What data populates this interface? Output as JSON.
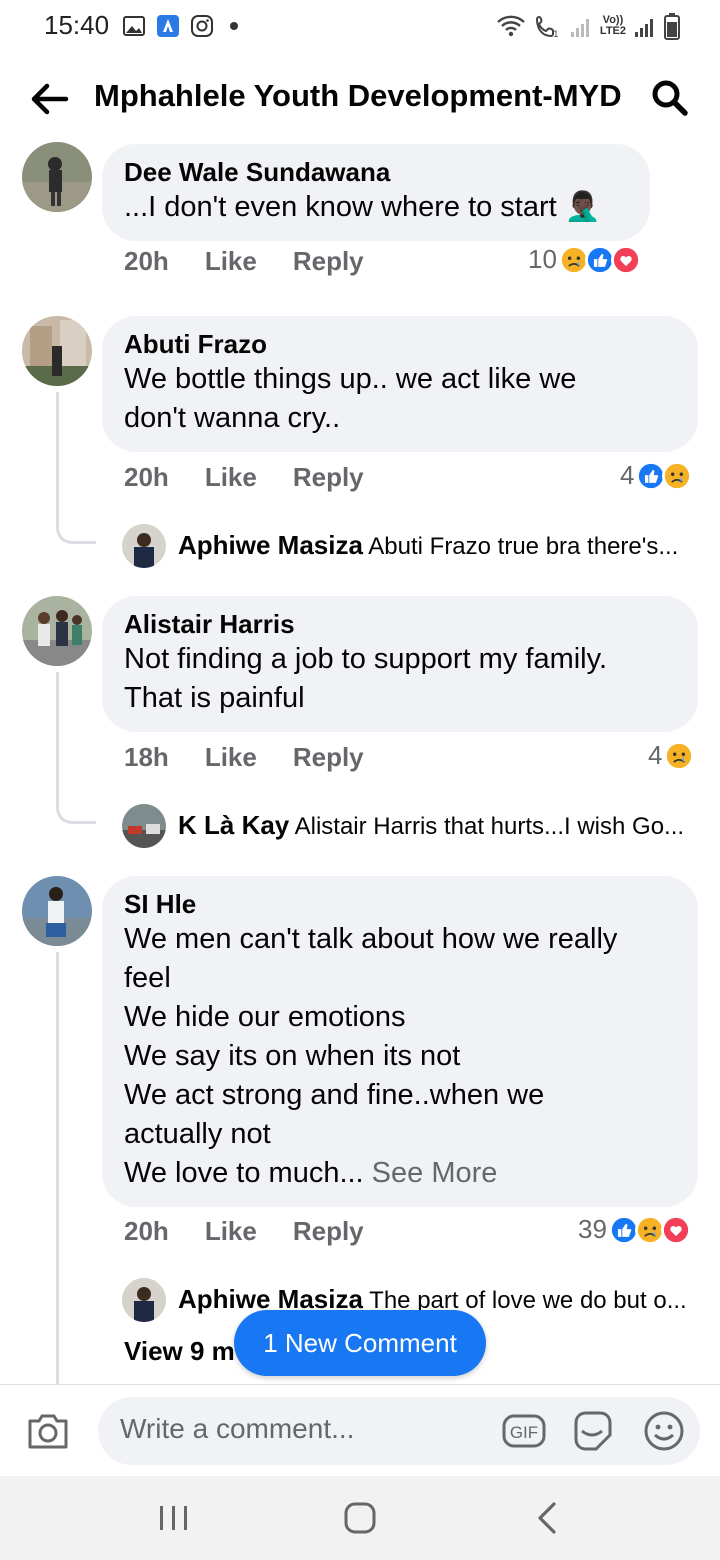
{
  "status": {
    "time": "15:40",
    "lte_top": "Vo))",
    "lte_bottom": "LTE2"
  },
  "header": {
    "title": "Mphahlele Youth Development-MYD"
  },
  "comments": [
    {
      "author": "Dee Wale Sundawana",
      "text": "...I don't even know where to start 🤦🏿‍♂️",
      "time": "20h",
      "like": "Like",
      "reply": "Reply",
      "reaction_count": "10",
      "reactions": [
        "sad",
        "like",
        "love"
      ]
    },
    {
      "author": "Abuti Frazo",
      "text": "We bottle things up.. we act like we\ndon't wanna cry..",
      "time": "20h",
      "like": "Like",
      "reply": "Reply",
      "reaction_count": "4",
      "reactions": [
        "like",
        "sad"
      ],
      "reply_preview": {
        "author": "Aphiwe Masiza",
        "text": "Abuti Frazo  true bra there's..."
      }
    },
    {
      "author": "Alistair Harris",
      "text": "Not finding a job to support my family.\nThat is painful",
      "time": "18h",
      "like": "Like",
      "reply": "Reply",
      "reaction_count": "4",
      "reactions": [
        "sad"
      ],
      "reply_preview": {
        "author": "K Là Kay",
        "text": "Alistair Harris that hurts...I wish Go..."
      }
    },
    {
      "author": "SI Hle",
      "text": "We men can't talk about how we really\nfeel\nWe hide our emotions\nWe say its on when its not\nWe act strong and fine..when we\nactually not\nWe love to much...",
      "see_more": " See More",
      "time": "20h",
      "like": "Like",
      "reply": "Reply",
      "reaction_count": "39",
      "reactions": [
        "like",
        "sad",
        "love"
      ],
      "reply_preview": {
        "author": "Aphiwe Masiza",
        "text": "The part of love we do but o..."
      }
    }
  ],
  "view_more": "View 9 m",
  "new_comment_pill": "1 New Comment",
  "composer": {
    "placeholder": "Write a comment...",
    "gif_label": "GIF"
  },
  "colors": {
    "like": "#1877f2",
    "love": "#f33e58",
    "sad": "#f7b125",
    "bubble": "#f0f2f5"
  }
}
